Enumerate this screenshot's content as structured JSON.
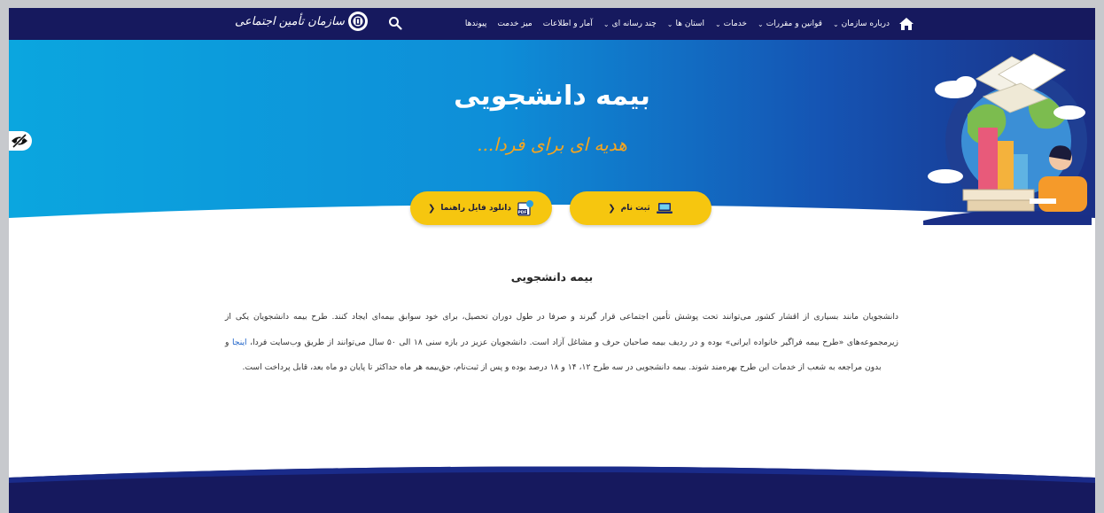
{
  "nav": {
    "home_icon": "home-icon",
    "items": [
      {
        "label": "درباره سازمان",
        "has_dropdown": true
      },
      {
        "label": "قوانین و مقررات",
        "has_dropdown": true
      },
      {
        "label": "خدمات",
        "has_dropdown": true
      },
      {
        "label": "استان ها",
        "has_dropdown": true
      },
      {
        "label": "چند رسانه ای",
        "has_dropdown": true
      },
      {
        "label": "آمار و اطلاعات",
        "has_dropdown": false
      },
      {
        "label": "میز خدمت",
        "has_dropdown": false
      },
      {
        "label": "پیوندها",
        "has_dropdown": false
      }
    ],
    "search_icon": "search-icon",
    "logo_text": "سازمان تأمین اجتماعی",
    "bg_color": "#16195e"
  },
  "hero": {
    "title": "بیمه دانشجویی",
    "subtitle": "هدیه ای برای فردا...",
    "buttons": [
      {
        "label": "ثبت نام",
        "icon": "laptop-icon"
      },
      {
        "label": "دانلود فایل راهنما",
        "icon": "pdf-icon"
      }
    ],
    "accent_color": "#f6c60f",
    "subtitle_color": "#f7a51e"
  },
  "accessibility_toggle_icon": "eye-slash-icon",
  "content": {
    "title": "بیمه دانشجویی",
    "paragraph_before_link": "دانشجویان مانند بسیاری از اقشار کشور می‌توانند تحت پوشش تأمین اجتماعی قرار گیرند و صرفا در طول دوران تحصیل، برای خود سوابق بیمه‌ای ایجاد کنند. طرح بیمه دانشجویان یکی از زیرمجموعه‌های «طرح بیمه فراگیر خانواده ایرانی» بوده و در ردیف بیمه صاحبان حرف و مشاغل آزاد است. دانشجویان عزیز در بازه سنی ۱۸ الی ۵۰ سال می‌توانند از طریق وب‌سایت فردا، ",
    "link_text": "اینجا",
    "paragraph_after_link": " و بدون مراجعه به شعب از خدمات این طرح بهره‌مند شوند. بیمه دانشجویی در سه طرح ۱۲، ۱۴ و ۱۸ درصد بوده و پس از ثبت‌نام، حق‌بیمه هر ماه حداکثر تا پایان دو ماه بعد، قابل پرداخت است."
  }
}
